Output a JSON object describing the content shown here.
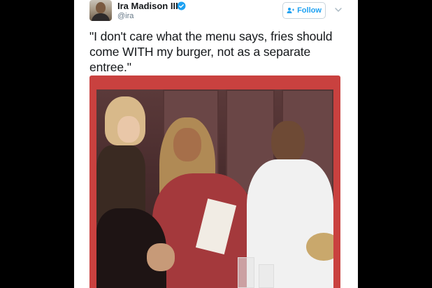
{
  "tweet": {
    "display_name": "Ira Madison III",
    "handle": "@ira",
    "follow_label": "Follow",
    "text": "\"I don't care what the menu says, fries should come WITH my burger, not as a separate entree.\""
  },
  "icons": {
    "verified": "verified-badge-icon",
    "follow": "add-user-icon",
    "more": "chevron-down-icon"
  },
  "colors": {
    "accent": "#1da1f2",
    "frame": "#c9413f"
  }
}
